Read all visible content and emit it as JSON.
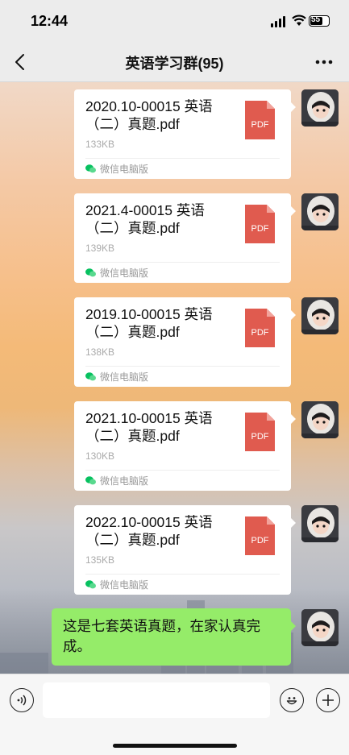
{
  "status_bar": {
    "time": "12:44",
    "battery": "55"
  },
  "nav": {
    "title": "英语学习群(95)"
  },
  "files": [
    {
      "name": "2020.10-00015 英语（二）真题.pdf",
      "size": "133KB",
      "source": "微信电脑版",
      "icon_label": "PDF"
    },
    {
      "name": "2021.4-00015 英语（二）真题.pdf",
      "size": "139KB",
      "source": "微信电脑版",
      "icon_label": "PDF"
    },
    {
      "name": "2019.10-00015 英语（二）真题.pdf",
      "size": "138KB",
      "source": "微信电脑版",
      "icon_label": "PDF"
    },
    {
      "name": "2021.10-00015 英语（二）真题.pdf",
      "size": "130KB",
      "source": "微信电脑版",
      "icon_label": "PDF"
    },
    {
      "name": "2022.10-00015 英语（二）真题.pdf",
      "size": "135KB",
      "source": "微信电脑版",
      "icon_label": "PDF"
    }
  ],
  "text_message": "这是七套英语真题，在家认真完成。",
  "colors": {
    "bubble_green": "#95ec69",
    "pdf_red": "#e05b4f",
    "wechat_green": "#07c160"
  },
  "icons": [
    "back-icon",
    "more-icon",
    "voice-icon",
    "emoji-icon",
    "plus-icon",
    "pdf-icon",
    "wechat-pc-icon"
  ]
}
